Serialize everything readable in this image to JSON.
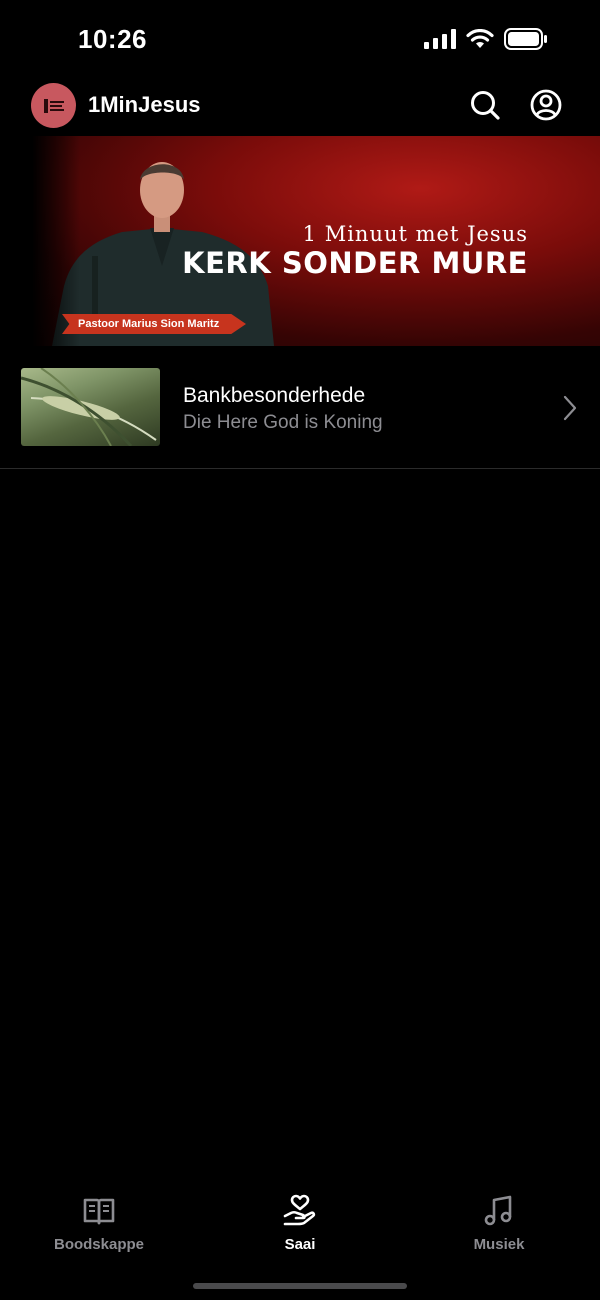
{
  "status_bar": {
    "time": "10:26"
  },
  "header": {
    "logo_text": "1",
    "title": "1MinJesus",
    "icons": {
      "search": "search-icon",
      "profile": "profile-icon"
    }
  },
  "banner": {
    "subtitle": "1 Minuut met Jesus",
    "title": "KERK SONDER MURE",
    "speaker": "Pastoor Marius Sion Maritz"
  },
  "list": [
    {
      "title": "Bankbesonderhede",
      "subtitle": "Die Here God is Koning",
      "icon": "chevron-right-icon"
    }
  ],
  "tab_bar": {
    "active": "Saai",
    "tabs": [
      {
        "label": "Boodskappe",
        "icon": "book-icon"
      },
      {
        "label": "Saai",
        "icon": "hand-heart-icon"
      },
      {
        "label": "Musiek",
        "icon": "music-note-icon"
      }
    ]
  },
  "colors": {
    "accent": "#c8585f",
    "secondary_text": "#8d8d92",
    "background": "#000000"
  }
}
